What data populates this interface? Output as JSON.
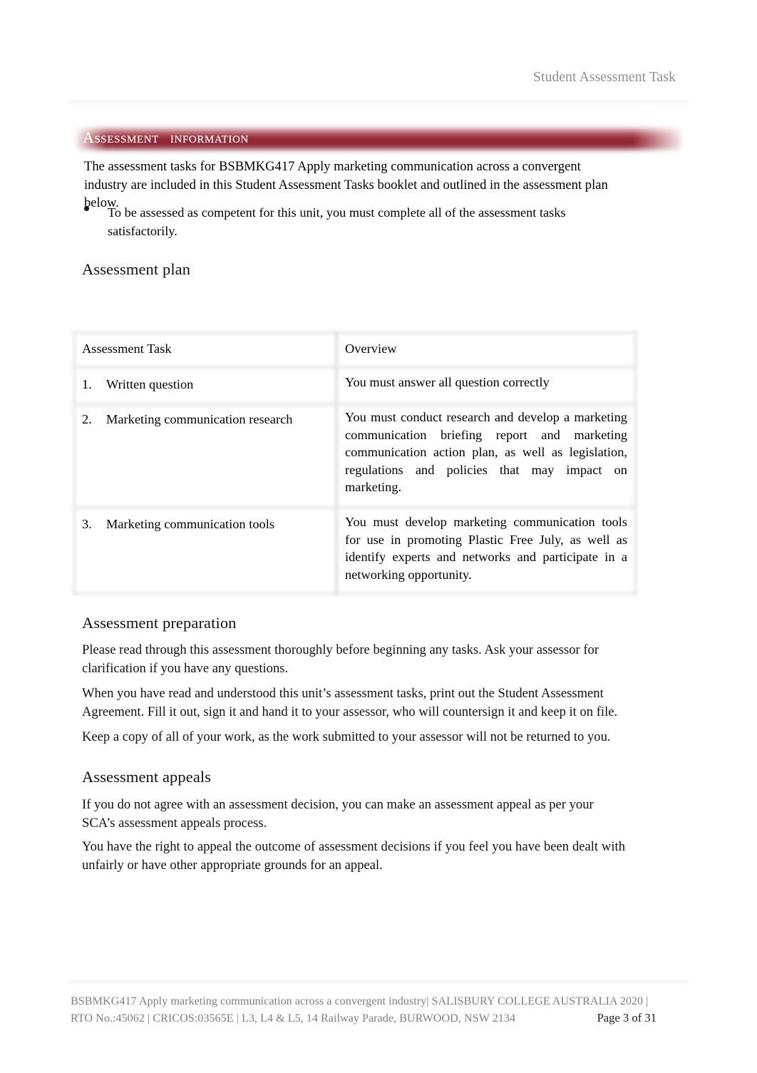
{
  "header": {
    "title": "Student Assessment Task"
  },
  "banner": {
    "title_part1": "Assessment",
    "title_part2": "information",
    "color": "#8a2230"
  },
  "intro": {
    "paragraph": "The assessment tasks for BSBMKG417 Apply marketing communication across a convergent industry are included in this Student Assessment Tasks booklet and outlined in the assessment plan below.",
    "bullet": "To be assessed as competent for this unit, you must complete all of the assessment tasks satisfactorily."
  },
  "sections": {
    "plan_heading": "Assessment plan",
    "preparation_heading": "Assessment preparation",
    "appeals_heading": "Assessment appeals"
  },
  "plan_table": {
    "columns": [
      "Assessment Task",
      "Overview"
    ],
    "rows": [
      {
        "number": "1.",
        "task": "Written question",
        "overview": "You must answer all question correctly"
      },
      {
        "number": "2.",
        "task": "Marketing communication research",
        "overview": "You must conduct research and develop a marketing communication briefing report and marketing communication action plan, as well as legislation, regulations and policies that may impact on marketing."
      },
      {
        "number": "3.",
        "task": "Marketing communication tools",
        "overview": "You must develop marketing communication tools for use in promoting Plastic Free July, as well as identify experts and networks and participate in a networking opportunity."
      }
    ]
  },
  "preparation": {
    "p1": "Please read through this assessment thoroughly before beginning any tasks. Ask your assessor for clarification if you have any questions.",
    "p2": "When you have read and understood this unit’s assessment tasks, print out the Student Assessment Agreement. Fill it out, sign it and hand it to your assessor, who will countersign it and keep it on file.",
    "p3": "Keep a copy of all of your work, as the work submitted to your assessor will not be returned to you."
  },
  "appeals": {
    "p1": "If you do not agree with an assessment decision, you can make an assessment appeal as per your SCA’s assessment appeals process.",
    "p2": "You have the right to appeal the outcome of assessment decisions if you feel you have been dealt with unfairly or have other appropriate grounds for an appeal."
  },
  "footer": {
    "line1": "BSBMKG417 Apply marketing communication across a convergent industry| SALISBURY COLLEGE AUSTRALIA 2020 |",
    "line2": "RTO No.:45062 | CRICOS:03565E | L3, L4 & L5, 14 Railway Parade, BURWOOD, NSW 2134",
    "page": "Page 3 of 31"
  }
}
